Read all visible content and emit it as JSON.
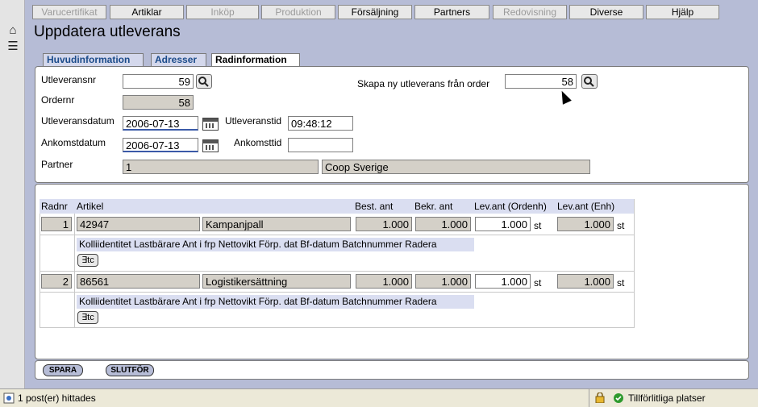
{
  "nav": {
    "items": [
      {
        "label": "Varucertifikat",
        "disabled": true
      },
      {
        "label": "Artiklar",
        "disabled": false
      },
      {
        "label": "Inköp",
        "disabled": true
      },
      {
        "label": "Produktion",
        "disabled": true
      },
      {
        "label": "Försäljning",
        "disabled": false
      },
      {
        "label": "Partners",
        "disabled": false
      },
      {
        "label": "Redovisning",
        "disabled": true
      },
      {
        "label": "Diverse",
        "disabled": false
      },
      {
        "label": "Hjälp",
        "disabled": false
      }
    ]
  },
  "page": {
    "title": "Uppdatera utleverans"
  },
  "tabs": [
    {
      "label": "Huvudinformation"
    },
    {
      "label": "Adresser"
    },
    {
      "label": "Radinformation"
    }
  ],
  "form": {
    "utleveransnr_label": "Utleveransnr",
    "utleveransnr": "59",
    "skapa_label": "Skapa ny utleverans från order",
    "skapa_value": "58",
    "ordernr_label": "Ordernr",
    "ordernr": "58",
    "utlevdatum_label": "Utleveransdatum",
    "utlevdatum": "2006-07-13",
    "utlevtid_label": "Utleveranstid",
    "utlevtid": "09:48:12",
    "ankomstdatum_label": "Ankomstdatum",
    "ankomstdatum": "2006-07-13",
    "ankomsttid_label": "Ankomsttid",
    "ankomsttid": "",
    "partner_label": "Partner",
    "partner_id": "1",
    "partner_name": "Coop Sverige"
  },
  "grid": {
    "headers": {
      "radnr": "Radnr",
      "artikel": "Artikel",
      "best": "Best. ant",
      "bekr": "Bekr. ant",
      "levord": "Lev.ant (Ordenh)",
      "levenh": "Lev.ant (Enh)"
    },
    "sub_headers": "Kolliidentitet Lastbärare Ant i frp Nettovikt Förp. dat Bf-datum Batchnummer Radera",
    "rows": [
      {
        "radnr": "1",
        "artnr": "42947",
        "artnamn": "Kampanjpall",
        "best": "1.000",
        "bekr": "1.000",
        "levord": "1.000",
        "unit1": "st",
        "levenh": "1.000",
        "unit2": "st",
        "btn": "∃tc"
      },
      {
        "radnr": "2",
        "artnr": "86561",
        "artnamn": "Logistikersättning",
        "best": "1.000",
        "bekr": "1.000",
        "levord": "1.000",
        "unit1": "st",
        "levenh": "1.000",
        "unit2": "st",
        "btn": "∃tc"
      }
    ]
  },
  "actions": {
    "spara": "SPARA",
    "slutfor": "SLUTFÖR"
  },
  "status": {
    "left": "1 post(er) hittades",
    "right": "Tillförlitliga platser"
  }
}
